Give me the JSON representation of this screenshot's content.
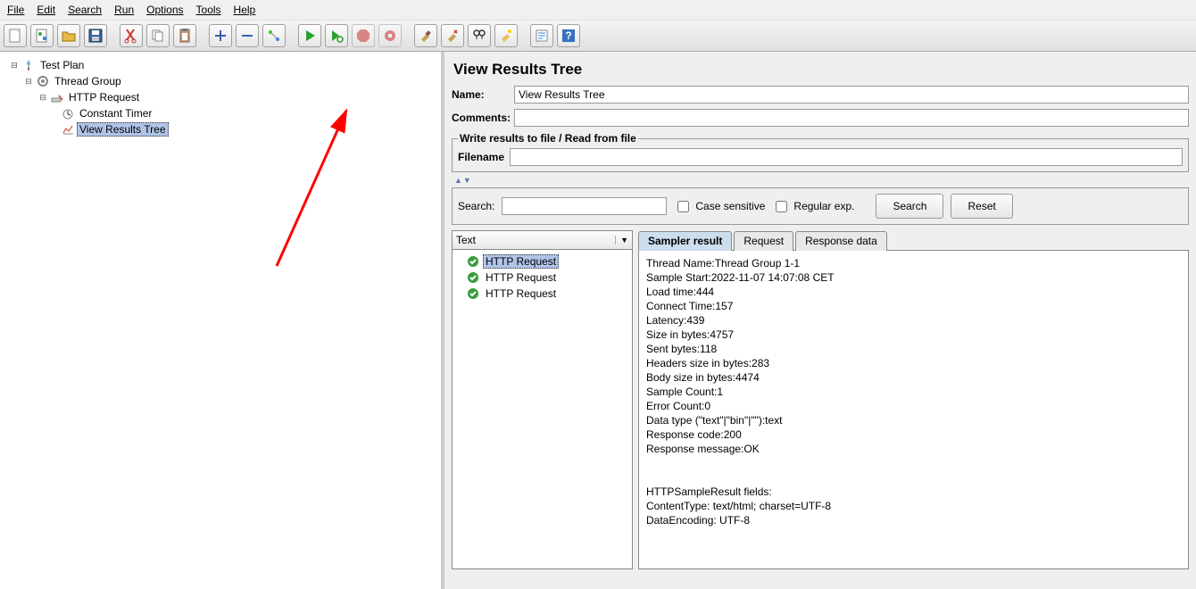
{
  "menus": [
    "File",
    "Edit",
    "Search",
    "Run",
    "Options",
    "Tools",
    "Help"
  ],
  "tree": {
    "testplan": "Test Plan",
    "threadgroup": "Thread Group",
    "httprequest": "HTTP Request",
    "constanttimer": "Constant Timer",
    "viewresults": "View Results Tree"
  },
  "panel": {
    "title": "View Results Tree",
    "name_label": "Name:",
    "name_value": "View Results Tree",
    "comments_label": "Comments:",
    "comments_value": "",
    "group_legend": "Write results to file / Read from file",
    "filename_label": "Filename",
    "filename_value": ""
  },
  "search": {
    "label": "Search:",
    "value": "",
    "case_label": "Case sensitive",
    "regex_label": "Regular exp.",
    "search_btn": "Search",
    "reset_btn": "Reset"
  },
  "results": {
    "dropdown": "Text",
    "items": [
      "HTTP Request",
      "HTTP Request",
      "HTTP Request"
    ],
    "tabs": [
      "Sampler result",
      "Request",
      "Response data"
    ],
    "detail_lines": [
      "Thread Name:Thread Group 1-1",
      "Sample Start:2022-11-07 14:07:08 CET",
      "Load time:444",
      "Connect Time:157",
      "Latency:439",
      "Size in bytes:4757",
      "Sent bytes:118",
      "Headers size in bytes:283",
      "Body size in bytes:4474",
      "Sample Count:1",
      "Error Count:0",
      "Data type (\"text\"|\"bin\"|\"\"):text",
      "Response code:200",
      "Response message:OK",
      "",
      "",
      "HTTPSampleResult fields:",
      "ContentType: text/html; charset=UTF-8",
      "DataEncoding: UTF-8"
    ]
  }
}
